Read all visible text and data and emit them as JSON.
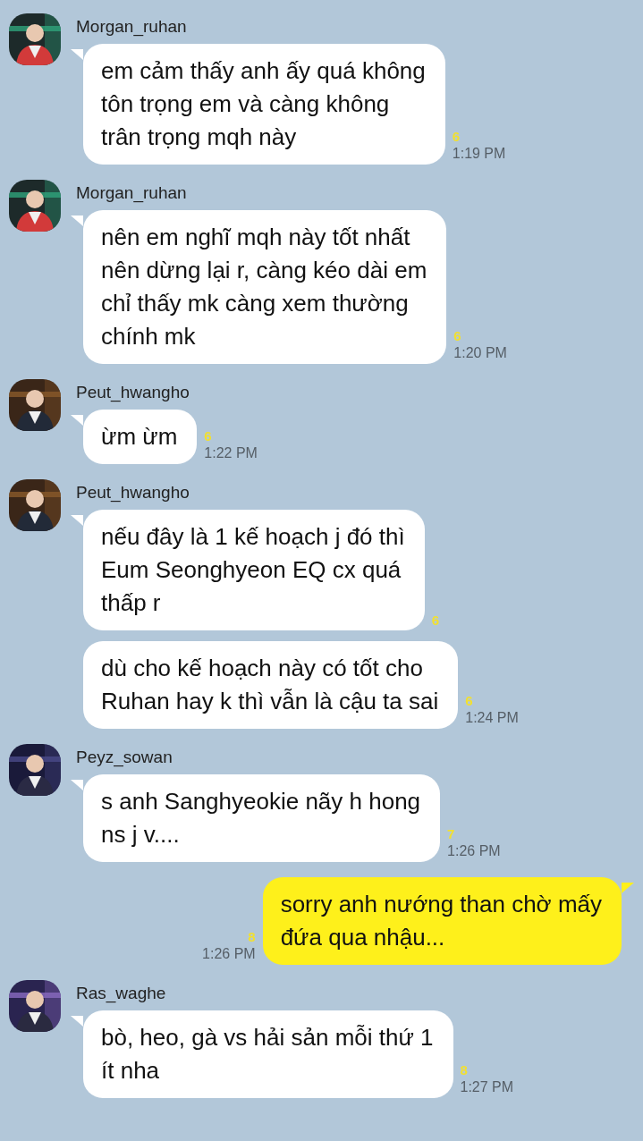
{
  "messages": [
    {
      "kind": "incoming",
      "sender": "Morgan_ruhan",
      "avatar": {
        "kind": "picture"
      },
      "bubbles": [
        {
          "lines": [
            "em cảm thấy anh ấy quá không",
            "tôn trọng em và càng không",
            "trân trọng mqh này"
          ],
          "unread": "6",
          "time": "1:19 PM"
        }
      ]
    },
    {
      "kind": "incoming",
      "sender": "Morgan_ruhan",
      "avatar": {
        "kind": "picture"
      },
      "bubbles": [
        {
          "lines": [
            "nên em nghĩ mqh này tốt nhất",
            "nên dừng lại r, càng kéo dài em",
            "chỉ thấy mk càng xem thường",
            "chính mk"
          ],
          "unread": "6",
          "time": "1:20 PM"
        }
      ]
    },
    {
      "kind": "incoming",
      "sender": "Peut_hwangho",
      "avatar": {
        "kind": "picture"
      },
      "bubbles": [
        {
          "lines": [
            "ừm ừm"
          ],
          "unread": "6",
          "time": "1:22 PM"
        }
      ]
    },
    {
      "kind": "incoming",
      "sender": "Peut_hwangho",
      "avatar": {
        "kind": "picture"
      },
      "bubbles": [
        {
          "lines": [
            "nếu đây là 1 kế hoạch j đó thì",
            "Eum Seonghyeon EQ cx quá",
            "thấp r"
          ],
          "unread": "6"
        },
        {
          "lines": [
            "dù cho kế hoạch này có tốt cho",
            "Ruhan hay k thì vẫn là cậu ta sai"
          ],
          "unread": "6",
          "time": "1:24 PM"
        }
      ]
    },
    {
      "kind": "incoming",
      "sender": "Peyz_sowan",
      "avatar": {
        "kind": "picture"
      },
      "bubbles": [
        {
          "lines": [
            "s anh Sanghyeokie nãy h hong",
            "ns j v...."
          ],
          "unread": "7",
          "time": "1:26 PM"
        }
      ]
    },
    {
      "kind": "outgoing",
      "bubbles": [
        {
          "lines": [
            "sorry anh nướng than chờ mấy",
            "đứa qua nhậu..."
          ],
          "unread": "8",
          "time": "1:26 PM"
        }
      ]
    },
    {
      "kind": "incoming",
      "sender": "Ras_waghe",
      "avatar": {
        "kind": "picture"
      },
      "bubbles": [
        {
          "lines": [
            "bò, heo, gà vs hải sản mỗi thứ 1",
            "ít nha"
          ],
          "unread": "8",
          "time": "1:27 PM"
        }
      ]
    }
  ]
}
